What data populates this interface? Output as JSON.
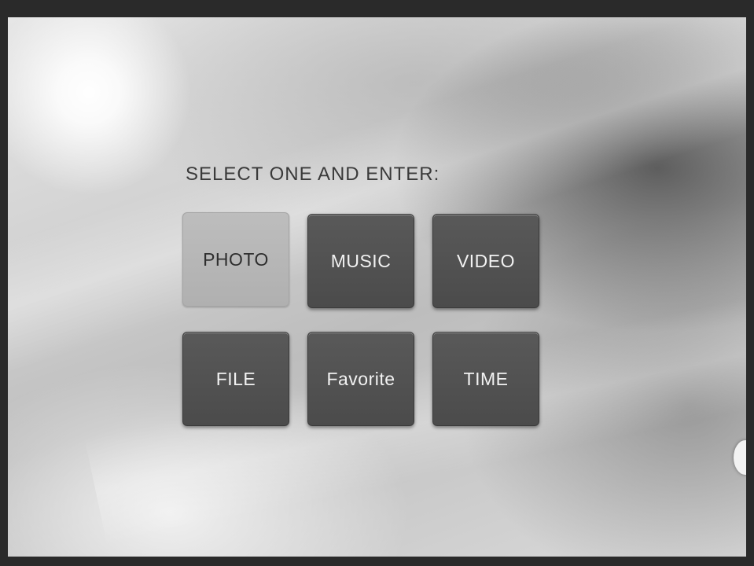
{
  "menu": {
    "prompt": "SELECT ONE AND ENTER:",
    "selected": "PHOTO",
    "items": [
      {
        "label": "PHOTO"
      },
      {
        "label": "MUSIC"
      },
      {
        "label": "VIDEO"
      },
      {
        "label": "FILE"
      },
      {
        "label": "Favorite"
      },
      {
        "label": "TIME"
      }
    ]
  },
  "colors": {
    "tile": "#4f4f4f",
    "tile_selected": "#b8b8b8",
    "frame": "#2a2a2a"
  }
}
